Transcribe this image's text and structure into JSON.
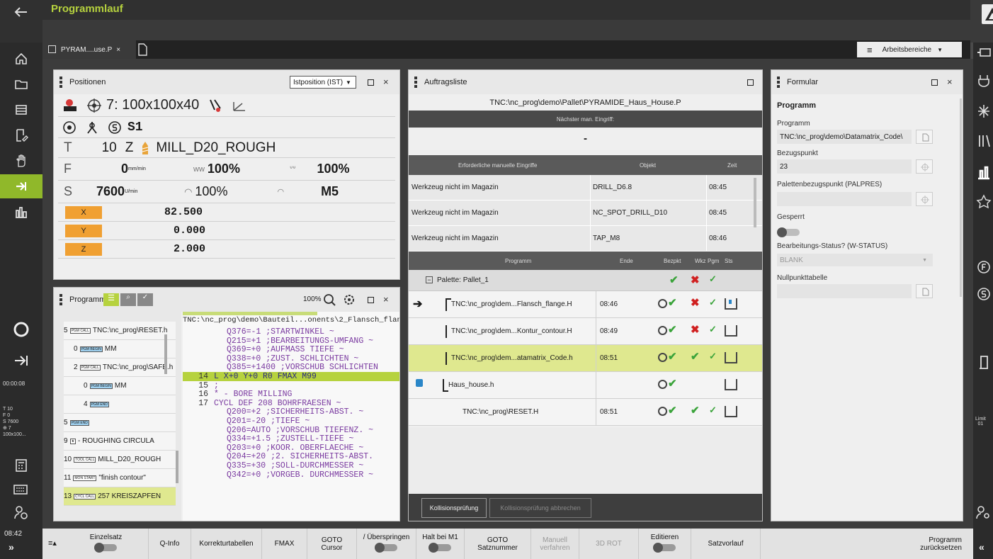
{
  "window": {
    "title": "Programmlauf"
  },
  "tabs": [
    {
      "label": "PYRAM....use.P"
    }
  ],
  "workspace_menu": "Arbeitsbereiche",
  "leftbar": {
    "timer": "00:00:08",
    "info": [
      "T 10",
      "F 0",
      "S 7600",
      "⊕ 7",
      "100x100..."
    ],
    "clock": "08:42"
  },
  "rightbar": {
    "limit": "Limit",
    "limit_num": "01"
  },
  "positions": {
    "title": "Positionen",
    "mode": "Istposition (IST)",
    "preset": "7: 100x100x40",
    "spindle": "S1",
    "tool_num": "10",
    "tool_axis": "Z",
    "tool_name": "MILL_D20_ROUGH",
    "f_value": "0",
    "f_unit": "mm/min",
    "f_override": "100%",
    "f_rapid": "100%",
    "s_value": "7600",
    "s_unit": "U/min",
    "s_override": "100%",
    "m_func": "M5",
    "axes": [
      {
        "name": "X",
        "value": "82.500"
      },
      {
        "name": "Y",
        "value": "0.000"
      },
      {
        "name": "Z",
        "value": "2.000"
      }
    ]
  },
  "program": {
    "title": "Programm",
    "zoom": "100%",
    "list": [
      {
        "num": "5",
        "tag": "PGM CALL",
        "text": "TNC:\\nc_prog\\RESET.h"
      },
      {
        "num": "0",
        "tag": "PGM BEGIN",
        "text": "MM"
      },
      {
        "num": "2",
        "tag": "PGM CALL",
        "text": "TNC:\\nc_prog\\SAFE.h"
      },
      {
        "num": "0",
        "tag": "PGM BEGIN",
        "text": "MM"
      },
      {
        "num": "4",
        "tag": "PGM END",
        "text": ""
      },
      {
        "num": "5",
        "tag": "PGM END",
        "text": ""
      },
      {
        "num": "9",
        "tag": "★",
        "text": "- ROUGHING CIRCULA"
      },
      {
        "num": "10",
        "tag": "TOOL CALL",
        "text": "MILL_D20_ROUGH"
      },
      {
        "num": "11",
        "tag": "MON START",
        "text": "\"finish contour\""
      },
      {
        "num": "13",
        "tag": "CYCL CALL",
        "text": "257 KREISZAPFEN"
      }
    ],
    "path": "TNC:\\nc_prog\\demo\\Bauteil...onents\\2_Flansch_flange.H",
    "code": [
      {
        "n": "",
        "t": "Q376=-1 ;STARTWINKEL ~"
      },
      {
        "n": "",
        "t": "Q215=+1 ;BEARBEITUNGS-UMFANG ~"
      },
      {
        "n": "",
        "t": "Q369=+0 ;AUFMASS TIEFE ~"
      },
      {
        "n": "",
        "t": "Q338=+0 ;ZUST. SCHLICHTEN ~"
      },
      {
        "n": "",
        "t": "Q385=+1400 ;VORSCHUB SCHLICHTEN"
      },
      {
        "n": "14",
        "t": "L X+0 Y+0 R0 FMAX M99"
      },
      {
        "n": "15",
        "t": ";"
      },
      {
        "n": "16",
        "t": "* - BORE MILLING"
      },
      {
        "n": "17",
        "t": "CYCL DEF 208 BOHRFRAESEN ~"
      },
      {
        "n": "",
        "t": "Q200=+2 ;SICHERHEITS-ABST. ~"
      },
      {
        "n": "",
        "t": "Q201=-20 ;TIEFE ~"
      },
      {
        "n": "",
        "t": "Q206=AUTO ;VORSCHUB TIEFENZ. ~"
      },
      {
        "n": "",
        "t": "Q334=+1.5 ;ZUSTELL-TIEFE ~"
      },
      {
        "n": "",
        "t": "Q203=+0 ;KOOR. OBERFLAECHE ~"
      },
      {
        "n": "",
        "t": "Q204=+20 ;2. SICHERHEITS-ABST."
      },
      {
        "n": "",
        "t": "Q335=+30 ;SOLL-DURCHMESSER ~"
      },
      {
        "n": "",
        "t": "Q342=+0 ;VORGEB. DURCHMESSER ~"
      }
    ]
  },
  "jobs": {
    "title": "Auftragsliste",
    "path": "TNC:\\nc_prog\\demo\\Pallet\\PYRAMIDE_Haus_House.P",
    "next_label": "Nächster man. Eingriff:",
    "next_value": "-",
    "req_head": [
      "Erforderliche manuelle Eingriffe",
      "Objekt",
      "Zeit"
    ],
    "req_rows": [
      [
        "Werkzeug nicht im Magazin",
        "DRILL_D6.8",
        "08:45"
      ],
      [
        "Werkzeug nicht im Magazin",
        "NC_SPOT_DRILL_D10",
        "08:45"
      ],
      [
        "Werkzeug nicht im Magazin",
        "TAP_M8",
        "08:46"
      ]
    ],
    "list_head": [
      "Programm",
      "Ende",
      "Bezpkt",
      "Wkz",
      "Pgm",
      "Sts"
    ],
    "pallet": "Palette: Pallet_1",
    "rows": [
      {
        "name": "TNC:\\nc_prog\\dem...Flansch_flange.H",
        "end": "08:46"
      },
      {
        "name": "TNC:\\nc_prog\\dem...Kontur_contour.H",
        "end": "08:49"
      },
      {
        "name": "TNC:\\nc_prog\\dem...atamatrix_Code.h",
        "end": "08:51"
      },
      {
        "name": "Haus_house.h",
        "end": ""
      },
      {
        "name": "TNC:\\nc_prog\\RESET.H",
        "end": "08:51"
      }
    ],
    "btn_collision": "Kollisionsprüfung",
    "btn_abort": "Kollisionsprüfung abbrechen"
  },
  "form": {
    "title": "Formular",
    "section": "Programm",
    "program_label": "Programm",
    "program_value": "TNC:\\nc_prog\\demo\\Datamatrix_Code\\",
    "ref_label": "Bezugspunkt",
    "ref_value": "23",
    "pal_label": "Palettenbezugspunkt (PALPRES)",
    "pal_value": "",
    "locked_label": "Gesperrt",
    "status_label": "Bearbeitungs-Status? (W-STATUS)",
    "status_value": "BLANK",
    "zero_label": "Nullpunkttabelle",
    "zero_value": ""
  },
  "softkeys": [
    {
      "label": "Einzelsatz",
      "toggle": true
    },
    {
      "label": "Q-Info"
    },
    {
      "label": "Korrekturtabellen"
    },
    {
      "label": "FMAX"
    },
    {
      "label": "GOTO",
      "sub": "Cursor"
    },
    {
      "label": "/ Überspringen",
      "toggle": true
    },
    {
      "label": "Halt bei M1",
      "toggle": true
    },
    {
      "label": "GOTO",
      "sub": "Satznummer"
    },
    {
      "label": "Manuell",
      "sub": "verfahren",
      "disabled": true
    },
    {
      "label": "3D ROT",
      "disabled": true
    },
    {
      "label": "Editieren",
      "toggle": true
    },
    {
      "label": "Satzvorlauf"
    },
    {
      "label": "Programm",
      "sub": "zurücksetzen"
    }
  ],
  "colors": {
    "accent": "#b6d23e",
    "active": "#90b82a",
    "axis": "#f0a032",
    "highlight": "#dfe88f"
  }
}
